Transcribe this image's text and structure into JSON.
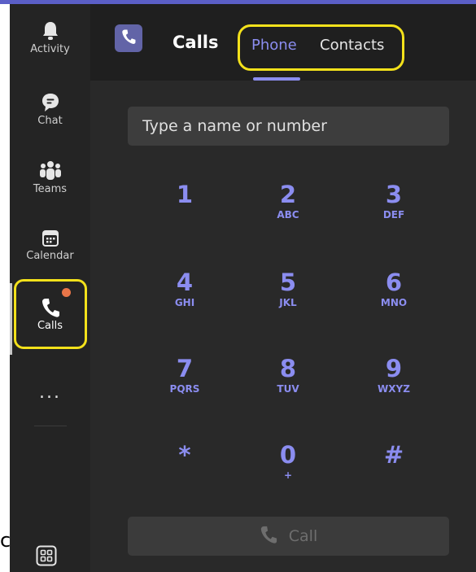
{
  "rail": {
    "items": [
      {
        "label": "Activity",
        "icon": "bell-icon"
      },
      {
        "label": "Chat",
        "icon": "chat-bubble-icon"
      },
      {
        "label": "Teams",
        "icon": "teams-icon"
      },
      {
        "label": "Calendar",
        "icon": "calendar-icon"
      },
      {
        "label": "Calls",
        "icon": "phone-icon",
        "active": true,
        "badge": true
      }
    ],
    "more_label": "...",
    "apps_icon": "apps-grid-icon"
  },
  "header": {
    "title": "Calls",
    "app_icon": "phone-icon",
    "tabs": [
      {
        "label": "Phone",
        "active": true
      },
      {
        "label": "Contacts",
        "active": false
      }
    ]
  },
  "dialer": {
    "search_placeholder": "Type a name or number",
    "keys": [
      {
        "digit": "1",
        "letters": ""
      },
      {
        "digit": "2",
        "letters": "ABC"
      },
      {
        "digit": "3",
        "letters": "DEF"
      },
      {
        "digit": "4",
        "letters": "GHI"
      },
      {
        "digit": "5",
        "letters": "JKL"
      },
      {
        "digit": "6",
        "letters": "MNO"
      },
      {
        "digit": "7",
        "letters": "PQRS"
      },
      {
        "digit": "8",
        "letters": "TUV"
      },
      {
        "digit": "9",
        "letters": "WXYZ"
      },
      {
        "digit": "*",
        "letters": ""
      },
      {
        "digit": "0",
        "letters": "+"
      },
      {
        "digit": "#",
        "letters": ""
      }
    ],
    "call_label": "Call"
  },
  "stray_text": "c",
  "colors": {
    "accent": "#8b8df0",
    "brand": "#6264a7",
    "highlight": "#f3e11b",
    "badge": "#e97548",
    "rail_bg": "#242424",
    "header_bg": "#1f1f1f",
    "main_bg": "#292929"
  }
}
